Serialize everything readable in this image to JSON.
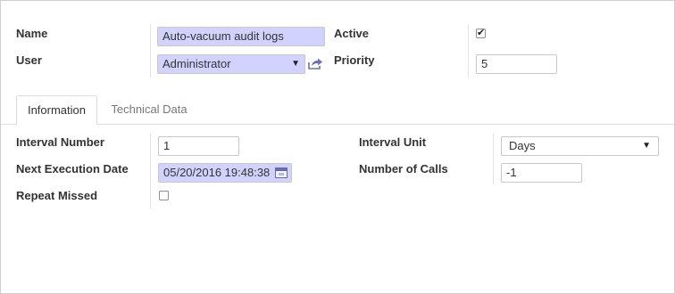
{
  "header": {
    "name_label": "Name",
    "name_value": "Auto-vacuum audit logs",
    "user_label": "User",
    "user_value": "Administrator",
    "active_label": "Active",
    "active_checked": true,
    "priority_label": "Priority",
    "priority_value": "5"
  },
  "tabs": [
    {
      "label": "Information",
      "active": true
    },
    {
      "label": "Technical Data",
      "active": false
    }
  ],
  "information": {
    "interval_number_label": "Interval Number",
    "interval_number_value": "1",
    "interval_unit_label": "Interval Unit",
    "interval_unit_value": "Days",
    "next_execution_label": "Next Execution Date",
    "next_execution_value": "05/20/2016 19:48:38",
    "number_of_calls_label": "Number of Calls",
    "number_of_calls_value": "-1",
    "repeat_missed_label": "Repeat Missed",
    "repeat_missed_checked": false
  },
  "icons": {
    "external_link": "external-link-icon",
    "calendar": "calendar-icon",
    "dropdown": "chevron-down-icon"
  },
  "colors": {
    "required_bg": "#d2d2ff",
    "border": "#c8c8c8",
    "separator": "#e3e3e3"
  }
}
